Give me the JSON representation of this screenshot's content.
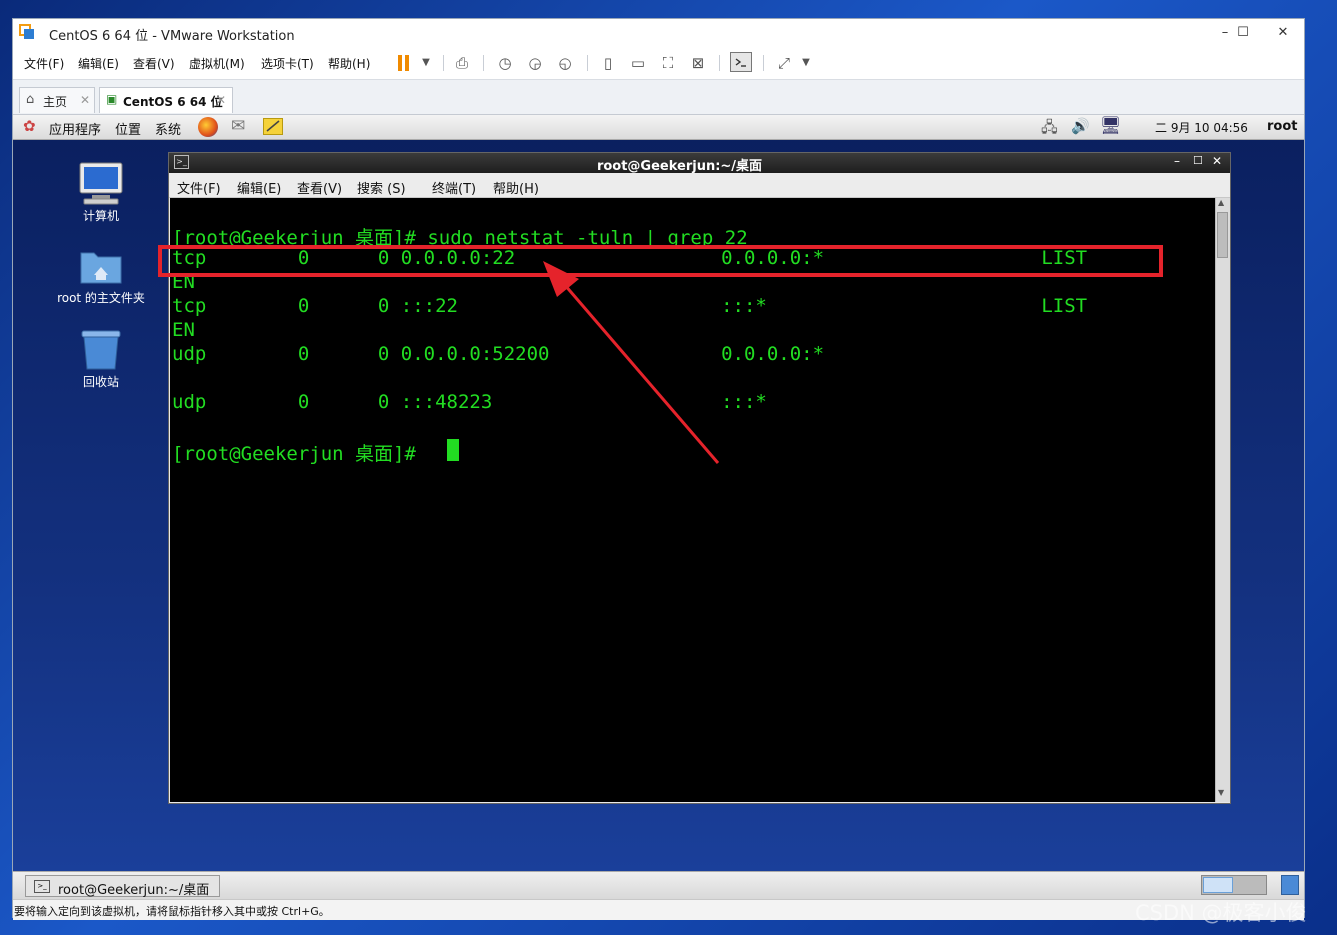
{
  "window": {
    "title": "CentOS 6 64 位 - VMware Workstation",
    "minimize": "–",
    "maximize": "☐",
    "close": "✕"
  },
  "menubar": {
    "items": [
      "文件(F)",
      "编辑(E)",
      "查看(V)",
      "虚拟机(M)",
      "选项卡(T)",
      "帮助(H)"
    ]
  },
  "tabs": [
    {
      "label": "主页",
      "close": "✕"
    },
    {
      "label": "CentOS 6 64 位",
      "close": "✕"
    }
  ],
  "gnome_panel": {
    "menus": [
      "应用程序",
      "位置",
      "系统"
    ],
    "clock": "二 9月 10 04:56",
    "user": "root"
  },
  "desktop_icons": [
    {
      "label": "计算机"
    },
    {
      "label": "root 的主文件夹"
    },
    {
      "label": "回收站"
    }
  ],
  "terminal": {
    "title": "root@Geekerjun:~/桌面",
    "menu": [
      "文件(F)",
      "编辑(E)",
      "查看(V)",
      "搜索 (S)",
      "终端(T)",
      "帮助(H)"
    ],
    "lines": [
      "[root@Geekerjun 桌面]# sudo netstat -tuln | grep 22",
      "tcp        0      0 0.0.0.0:22                  0.0.0.0:*                   LIST",
      "EN",
      "tcp        0      0 :::22                       :::*                        LIST",
      "EN",
      "udp        0      0 0.0.0.0:52200               0.0.0.0:*",
      "",
      "udp        0      0 :::48223                    :::*",
      "",
      "[root@Geekerjun 桌面]# "
    ]
  },
  "taskbar": {
    "item": "root@Geekerjun:~/桌面"
  },
  "statusbar": {
    "text": "要将输入定向到该虚拟机，请将鼠标指针移入其中或按 Ctrl+G。"
  },
  "watermark": "CSDN @极客小俊",
  "colors": {
    "terminal_fg": "#22dd22",
    "terminal_bg": "#000000",
    "highlight": "#e5232b",
    "pause_accent": "#f08a00"
  }
}
